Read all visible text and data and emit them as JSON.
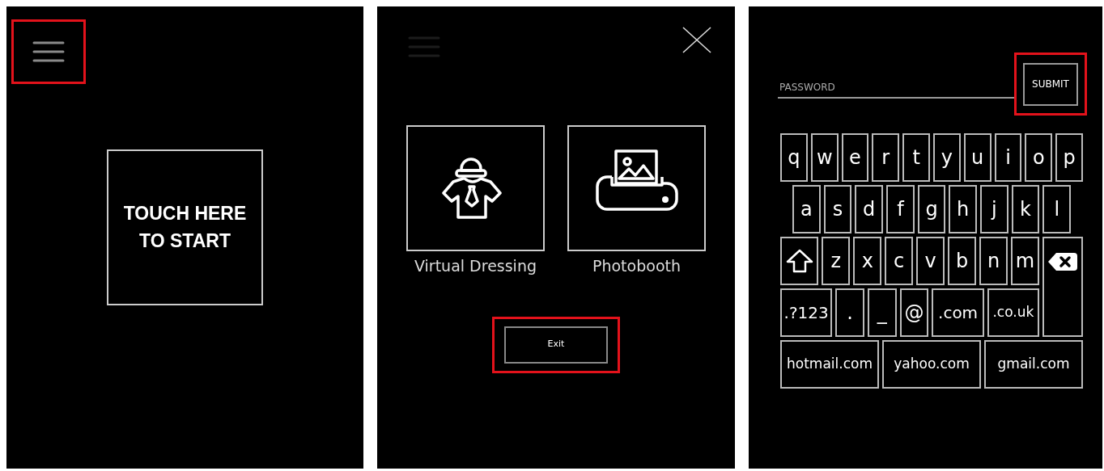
{
  "start_screen": {
    "menu_button": {
      "highlighted": true
    },
    "start_button": {
      "label": "TOUCH HERE TO START"
    }
  },
  "menu_screen": {
    "tiles": [
      {
        "kind": "dressing",
        "label": "Virtual Dressing"
      },
      {
        "kind": "photobooth",
        "label": "Photobooth"
      }
    ],
    "exit_button": {
      "label": "Exit",
      "highlighted": true
    }
  },
  "password_screen": {
    "password_field": {
      "placeholder": "PASSWORD"
    },
    "submit_button": {
      "label": "SUBMIT",
      "highlighted": true
    },
    "keyboard": {
      "key_rows": [
        {
          "keys": [
            {
              "kind": "char",
              "label": "q"
            },
            {
              "kind": "char",
              "label": "w"
            },
            {
              "kind": "char",
              "label": "e"
            },
            {
              "kind": "char",
              "label": "r"
            },
            {
              "kind": "char",
              "label": "t"
            },
            {
              "kind": "char",
              "label": "y"
            },
            {
              "kind": "char",
              "label": "u"
            },
            {
              "kind": "char",
              "label": "i"
            },
            {
              "kind": "char",
              "label": "o"
            },
            {
              "kind": "char",
              "label": "p"
            }
          ]
        },
        {
          "keys": [
            {
              "kind": "char",
              "label": "a"
            },
            {
              "kind": "char",
              "label": "s"
            },
            {
              "kind": "char",
              "label": "d"
            },
            {
              "kind": "char",
              "label": "f"
            },
            {
              "kind": "char",
              "label": "g"
            },
            {
              "kind": "char",
              "label": "h"
            },
            {
              "kind": "char",
              "label": "j"
            },
            {
              "kind": "char",
              "label": "k"
            },
            {
              "kind": "char",
              "label": "l"
            }
          ]
        },
        {
          "keys": [
            {
              "kind": "shift"
            },
            {
              "kind": "char",
              "label": "z"
            },
            {
              "kind": "char",
              "label": "x"
            },
            {
              "kind": "char",
              "label": "c"
            },
            {
              "kind": "char",
              "label": "v"
            },
            {
              "kind": "char",
              "label": "b"
            },
            {
              "kind": "char",
              "label": "n"
            },
            {
              "kind": "char",
              "label": "m"
            },
            {
              "kind": "backspace"
            }
          ]
        },
        {
          "keys": [
            {
              "kind": "char",
              "label": ".?123"
            },
            {
              "kind": "char",
              "label": "."
            },
            {
              "kind": "char",
              "label": "_"
            },
            {
              "kind": "char",
              "label": "@"
            },
            {
              "kind": "char",
              "label": ".com"
            },
            {
              "kind": "char",
              "label": ".co.uk"
            }
          ]
        },
        {
          "keys": [
            {
              "kind": "char",
              "label": "hotmail.com"
            },
            {
              "kind": "char",
              "label": "yahoo.com"
            },
            {
              "kind": "char",
              "label": "gmail.com"
            }
          ]
        }
      ]
    }
  }
}
